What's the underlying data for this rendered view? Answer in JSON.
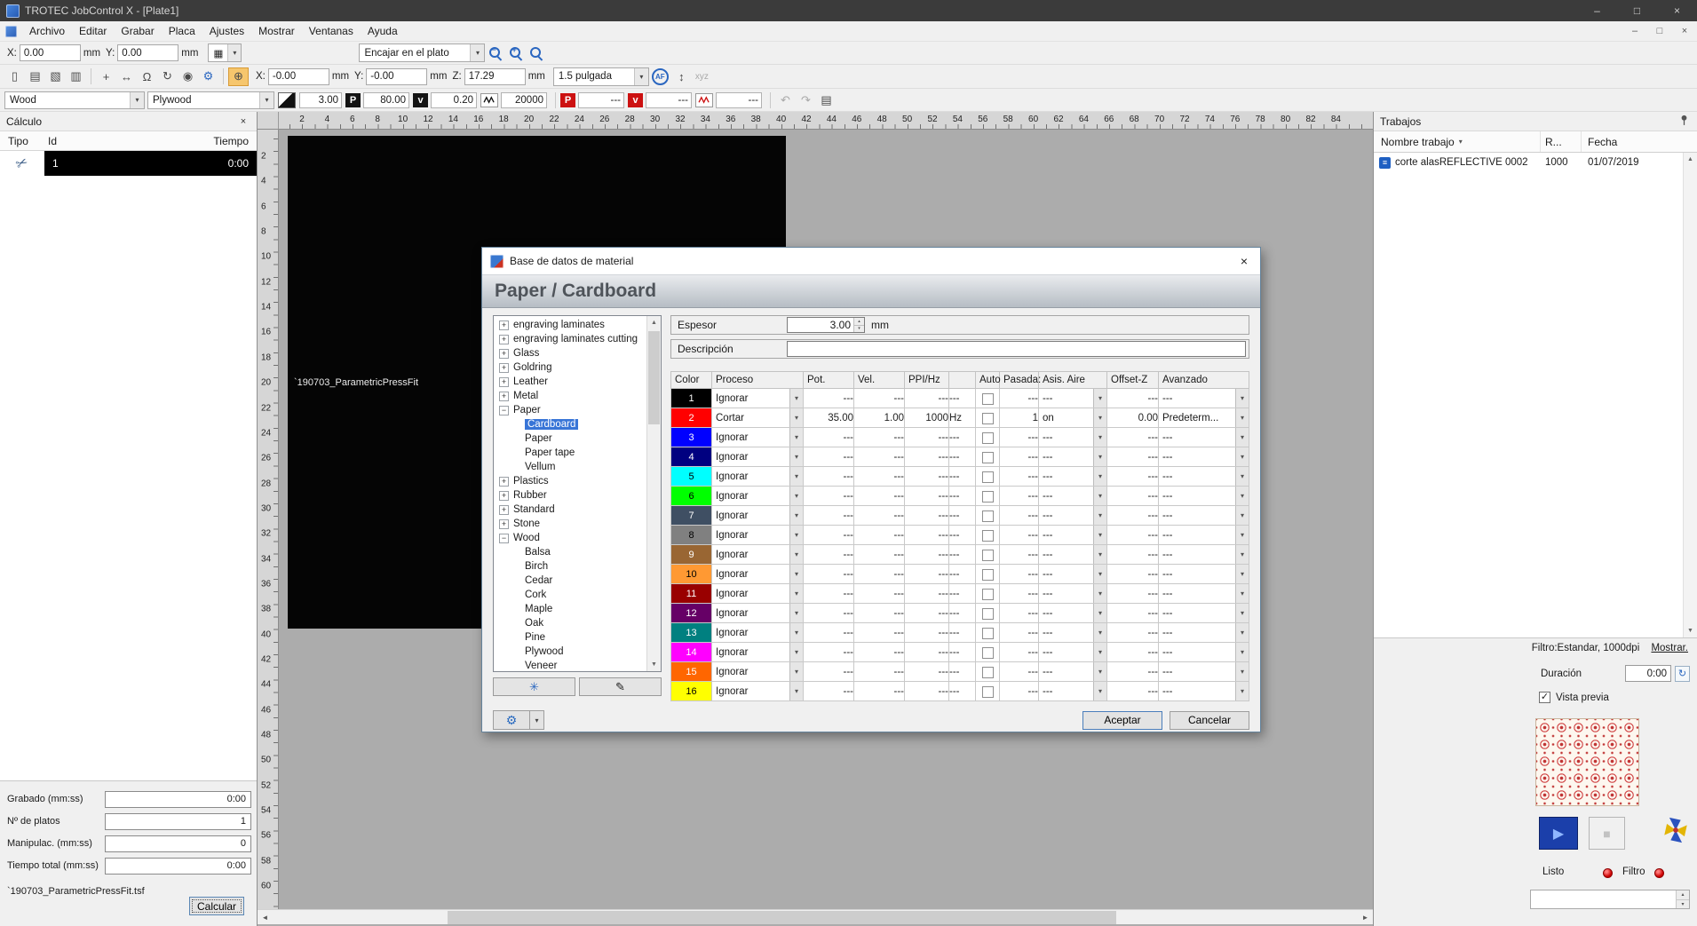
{
  "icons": {
    "minimize": "–",
    "maximize": "□",
    "close": "×",
    "dropdown": "▾",
    "spin_up": "▴",
    "spin_down": "▾",
    "check": "✓",
    "play": "▶",
    "stop": "■",
    "sort": "▾",
    "undo": "↶",
    "redo": "↷",
    "refresh": "↻",
    "scroll_left": "◄",
    "scroll_right": "►",
    "scroll_up": "▲",
    "scroll_down": "▼",
    "scissors": "✂",
    "gear": "⚙",
    "pen": "✎",
    "test_matrix": "✳",
    "new_file": "▯",
    "save": "▤",
    "open": "▧",
    "print": "▥",
    "select": "+",
    "move": "↔",
    "magnet": "Ω",
    "rotate": "↻",
    "eye": "◉",
    "laser_position": "⊕",
    "af": "AF",
    "z_axis": "↕",
    "xyz": "xyz",
    "grid": "▦",
    "doc": "≡"
  },
  "window": {
    "title": "TROTEC JobControl X - [Plate1]"
  },
  "menubar": {
    "items": [
      "Archivo",
      "Editar",
      "Grabar",
      "Placa",
      "Ajustes",
      "Mostrar",
      "Ventanas",
      "Ayuda"
    ]
  },
  "toolbar1": {
    "x_label": "X:",
    "x_value": "0.00",
    "x_unit": "mm",
    "y_label": "Y:",
    "y_value": "0.00",
    "y_unit": "mm",
    "zoom_mode": "Encajar en el plato"
  },
  "toolbar2": {
    "x_label": "X:",
    "x_value": "-0.00",
    "x_unit": "mm",
    "y_label": "Y:",
    "y_value": "-0.00",
    "y_unit": "mm",
    "z_label": "Z:",
    "z_value": "17.29",
    "z_unit": "mm",
    "lens": "1.5 pulgada"
  },
  "toolbar3": {
    "material_group": "Wood",
    "material": "Plywood",
    "thickness": "3.00",
    "p1_label": "P",
    "p1_value": "80.00",
    "v1_label": "v",
    "v1_value": "0.20",
    "f1_value": "20000",
    "p2_label": "P",
    "p2_value": "---",
    "v2_label": "v",
    "v2_value": "---",
    "f2_value": "---"
  },
  "calc_panel": {
    "title": "Cálculo",
    "col_tipo": "Tipo",
    "col_id": "Id",
    "col_tiempo": "Tiempo",
    "row_id": "1",
    "row_tiempo": "0:00",
    "fields": [
      {
        "label": "Grabado (mm:ss)",
        "value": "0:00"
      },
      {
        "label": "Nº de platos",
        "value": "1"
      },
      {
        "label": "Manipulac. (mm:ss)",
        "value": "0"
      },
      {
        "label": "Tiempo total (mm:ss)",
        "value": "0:00"
      }
    ],
    "file_name": "`190703_ParametricPressFit.tsf",
    "calc_button": "Calcular"
  },
  "canvas": {
    "job_label": "`190703_ParametricPressFit",
    "ruler_h": [
      2,
      4,
      6,
      8,
      10,
      12,
      14,
      16,
      18,
      20,
      22,
      24,
      26,
      28,
      30,
      32,
      34,
      36,
      38,
      40,
      42,
      44,
      46,
      48,
      50,
      52,
      54,
      56,
      58,
      60,
      62,
      64,
      66,
      68,
      70,
      72,
      74,
      76,
      78,
      80,
      82,
      84
    ],
    "ruler_v": [
      2,
      4,
      6,
      8,
      10,
      12,
      14,
      16,
      18,
      20,
      22,
      24,
      26,
      28,
      30,
      32,
      34,
      36,
      38,
      40,
      42,
      44,
      46,
      48,
      50,
      52,
      54,
      56,
      58,
      60
    ]
  },
  "jobs_panel": {
    "title": "Trabajos",
    "col_name": "Nombre trabajo",
    "col_r": "R...",
    "col_fecha": "Fecha",
    "rows": [
      {
        "name": "corte alasREFLECTIVE 0002",
        "r": "1000",
        "fecha": "01/07/2019"
      }
    ],
    "filter_text": "Filtro:Estandar, 1000dpi",
    "show_link": "Mostrar.",
    "duration_label": "Duración",
    "duration_value": "0:00",
    "preview_label": "Vista previa",
    "status_ready": "Listo",
    "status_filter": "Filtro"
  },
  "dialog": {
    "title": "Base de datos de material",
    "header": "Paper / Cardboard",
    "espesor_label": "Espesor",
    "espesor_value": "3.00",
    "espesor_unit": "mm",
    "descripcion_label": "Descripción",
    "descripcion_value": "",
    "tree": [
      {
        "label": "engraving laminates",
        "state": "collapsed"
      },
      {
        "label": "engraving laminates cutting",
        "state": "collapsed"
      },
      {
        "label": "Glass",
        "state": "collapsed"
      },
      {
        "label": "Goldring",
        "state": "collapsed"
      },
      {
        "label": "Leather",
        "state": "collapsed"
      },
      {
        "label": "Metal",
        "state": "collapsed"
      },
      {
        "label": "Paper",
        "state": "expanded",
        "children": [
          {
            "label": "Cardboard",
            "selected": true
          },
          {
            "label": "Paper"
          },
          {
            "label": "Paper tape"
          },
          {
            "label": "Vellum"
          }
        ]
      },
      {
        "label": "Plastics",
        "state": "collapsed"
      },
      {
        "label": "Rubber",
        "state": "collapsed"
      },
      {
        "label": "Standard",
        "state": "collapsed"
      },
      {
        "label": "Stone",
        "state": "collapsed"
      },
      {
        "label": "Wood",
        "state": "expanded",
        "children": [
          {
            "label": "Balsa"
          },
          {
            "label": "Birch"
          },
          {
            "label": "Cedar"
          },
          {
            "label": "Cork"
          },
          {
            "label": "Maple"
          },
          {
            "label": "Oak"
          },
          {
            "label": "Pine"
          },
          {
            "label": "Plywood"
          },
          {
            "label": "Veneer"
          }
        ]
      }
    ],
    "table": {
      "columns": [
        "Color",
        "Proceso",
        "Pot.",
        "Vel.",
        "PPI/Hz",
        "",
        "Auto",
        "Pasada:",
        "Asis. Aire",
        "Offset-Z",
        "Avanzado"
      ],
      "rows": [
        {
          "num": "1",
          "color": "#000000",
          "text": "#ffffff",
          "proceso": "Ignorar",
          "pot": "---",
          "vel": "---",
          "ppi": "---",
          "unit": "---",
          "auto": false,
          "pasadas": "---",
          "aire": "---",
          "offset": "---",
          "avanzado": "---"
        },
        {
          "num": "2",
          "color": "#ff0000",
          "text": "#ffffff",
          "proceso": "Cortar",
          "pot": "35.00",
          "vel": "1.00",
          "ppi": "1000",
          "unit": "Hz",
          "auto": false,
          "pasadas": "1",
          "aire": "on",
          "offset": "0.00",
          "avanzado": "Predeterm..."
        },
        {
          "num": "3",
          "color": "#0000ff",
          "text": "#ffffff",
          "proceso": "Ignorar",
          "pot": "---",
          "vel": "---",
          "ppi": "---",
          "unit": "---",
          "auto": false,
          "pasadas": "---",
          "aire": "---",
          "offset": "---",
          "avanzado": "---"
        },
        {
          "num": "4",
          "color": "#000080",
          "text": "#ffffff",
          "proceso": "Ignorar",
          "pot": "---",
          "vel": "---",
          "ppi": "---",
          "unit": "---",
          "auto": false,
          "pasadas": "---",
          "aire": "---",
          "offset": "---",
          "avanzado": "---"
        },
        {
          "num": "5",
          "color": "#00ffff",
          "text": "#000000",
          "proceso": "Ignorar",
          "pot": "---",
          "vel": "---",
          "ppi": "---",
          "unit": "---",
          "auto": false,
          "pasadas": "---",
          "aire": "---",
          "offset": "---",
          "avanzado": "---"
        },
        {
          "num": "6",
          "color": "#00ff00",
          "text": "#000000",
          "proceso": "Ignorar",
          "pot": "---",
          "vel": "---",
          "ppi": "---",
          "unit": "---",
          "auto": false,
          "pasadas": "---",
          "aire": "---",
          "offset": "---",
          "avanzado": "---"
        },
        {
          "num": "7",
          "color": "#3f4f63",
          "text": "#ffffff",
          "proceso": "Ignorar",
          "pot": "---",
          "vel": "---",
          "ppi": "---",
          "unit": "---",
          "auto": false,
          "pasadas": "---",
          "aire": "---",
          "offset": "---",
          "avanzado": "---"
        },
        {
          "num": "8",
          "color": "#808080",
          "text": "#000000",
          "proceso": "Ignorar",
          "pot": "---",
          "vel": "---",
          "ppi": "---",
          "unit": "---",
          "auto": false,
          "pasadas": "---",
          "aire": "---",
          "offset": "---",
          "avanzado": "---"
        },
        {
          "num": "9",
          "color": "#996633",
          "text": "#ffffff",
          "proceso": "Ignorar",
          "pot": "---",
          "vel": "---",
          "ppi": "---",
          "unit": "---",
          "auto": false,
          "pasadas": "---",
          "aire": "---",
          "offset": "---",
          "avanzado": "---"
        },
        {
          "num": "10",
          "color": "#ff9933",
          "text": "#000000",
          "proceso": "Ignorar",
          "pot": "---",
          "vel": "---",
          "ppi": "---",
          "unit": "---",
          "auto": false,
          "pasadas": "---",
          "aire": "---",
          "offset": "---",
          "avanzado": "---"
        },
        {
          "num": "11",
          "color": "#990000",
          "text": "#ffffff",
          "proceso": "Ignorar",
          "pot": "---",
          "vel": "---",
          "ppi": "---",
          "unit": "---",
          "auto": false,
          "pasadas": "---",
          "aire": "---",
          "offset": "---",
          "avanzado": "---"
        },
        {
          "num": "12",
          "color": "#660066",
          "text": "#ffffff",
          "proceso": "Ignorar",
          "pot": "---",
          "vel": "---",
          "ppi": "---",
          "unit": "---",
          "auto": false,
          "pasadas": "---",
          "aire": "---",
          "offset": "---",
          "avanzado": "---"
        },
        {
          "num": "13",
          "color": "#008080",
          "text": "#ffffff",
          "proceso": "Ignorar",
          "pot": "---",
          "vel": "---",
          "ppi": "---",
          "unit": "---",
          "auto": false,
          "pasadas": "---",
          "aire": "---",
          "offset": "---",
          "avanzado": "---"
        },
        {
          "num": "14",
          "color": "#ff00ff",
          "text": "#ffffff",
          "proceso": "Ignorar",
          "pot": "---",
          "vel": "---",
          "ppi": "---",
          "unit": "---",
          "auto": false,
          "pasadas": "---",
          "aire": "---",
          "offset": "---",
          "avanzado": "---"
        },
        {
          "num": "15",
          "color": "#ff6600",
          "text": "#ffffff",
          "proceso": "Ignorar",
          "pot": "---",
          "vel": "---",
          "ppi": "---",
          "unit": "---",
          "auto": false,
          "pasadas": "---",
          "aire": "---",
          "offset": "---",
          "avanzado": "---"
        },
        {
          "num": "16",
          "color": "#ffff00",
          "text": "#000000",
          "proceso": "Ignorar",
          "pot": "---",
          "vel": "---",
          "ppi": "---",
          "unit": "---",
          "auto": false,
          "pasadas": "---",
          "aire": "---",
          "offset": "---",
          "avanzado": "---"
        }
      ]
    },
    "accept": "Aceptar",
    "cancel": "Cancelar"
  }
}
